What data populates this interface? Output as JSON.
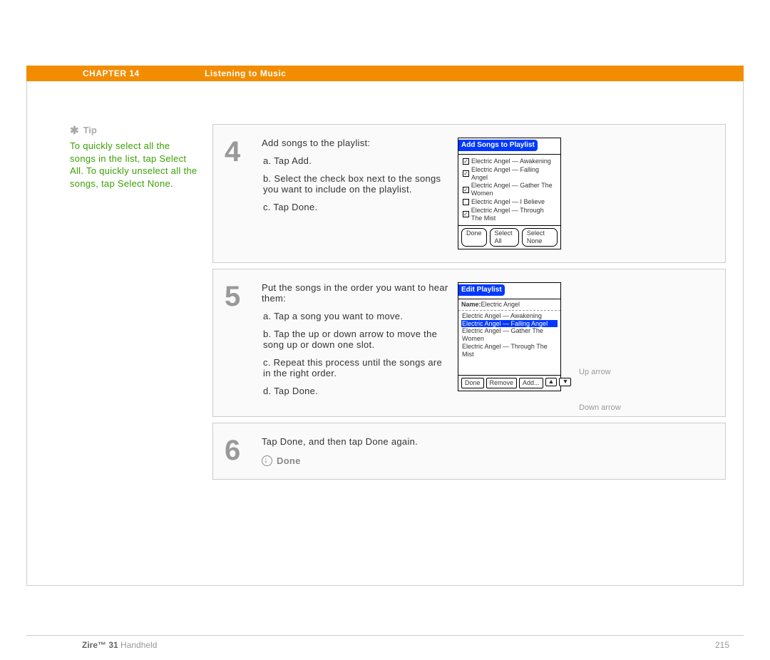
{
  "header": {
    "chapter": "CHAPTER 14",
    "title": "Listening to Music"
  },
  "tip": {
    "label": "Tip",
    "body": "To quickly select all the songs in the list, tap Select All. To quickly unselect all the songs, tap Select None."
  },
  "steps": [
    {
      "num": "4",
      "intro": "Add songs to the playlist:",
      "subs": [
        "a.  Tap Add.",
        "b.  Select the check box next to the songs you want to include on the playlist.",
        "c.  Tap Done."
      ],
      "screen": {
        "title": "Add Songs to Playlist",
        "songs": [
          {
            "checked": true,
            "label": "Electric Angel — Awakening"
          },
          {
            "checked": true,
            "label": "Electric Angel — Falling Angel"
          },
          {
            "checked": true,
            "label": "Electric Angel — Gather The Women"
          },
          {
            "checked": false,
            "label": "Electric Angel — I Believe"
          },
          {
            "checked": true,
            "label": "Electric Angel — Through The Mist"
          }
        ],
        "buttons": [
          "Done",
          "Select All",
          "Select None"
        ]
      }
    },
    {
      "num": "5",
      "intro": "Put the songs in the order you want to hear them:",
      "subs": [
        "a.  Tap a song you want to move.",
        "b.  Tap the up or down arrow to move the song up or down one slot.",
        "c.  Repeat this process until the songs are in the right order.",
        "d.  Tap Done."
      ],
      "screen": {
        "title": "Edit Playlist",
        "name_label": "Name:",
        "name_value": "Electric Angel",
        "songs": [
          {
            "sel": false,
            "label": "Electric Angel — Awakening"
          },
          {
            "sel": true,
            "label": "Electric Angel — Falling Angel"
          },
          {
            "sel": false,
            "label": "Electric Angel — Gather The Women"
          },
          {
            "sel": false,
            "label": "Electric Angel — Through The Mist"
          }
        ],
        "buttons": [
          "Done",
          "Remove",
          "Add..."
        ],
        "annot_up": "Up arrow",
        "annot_down": "Down arrow"
      }
    },
    {
      "num": "6",
      "intro": "Tap Done, and then tap Done again.",
      "done_label": "Done"
    }
  ],
  "footer": {
    "product_bold": "Zire™ 31",
    "product_rest": " Handheld",
    "page": "215"
  }
}
